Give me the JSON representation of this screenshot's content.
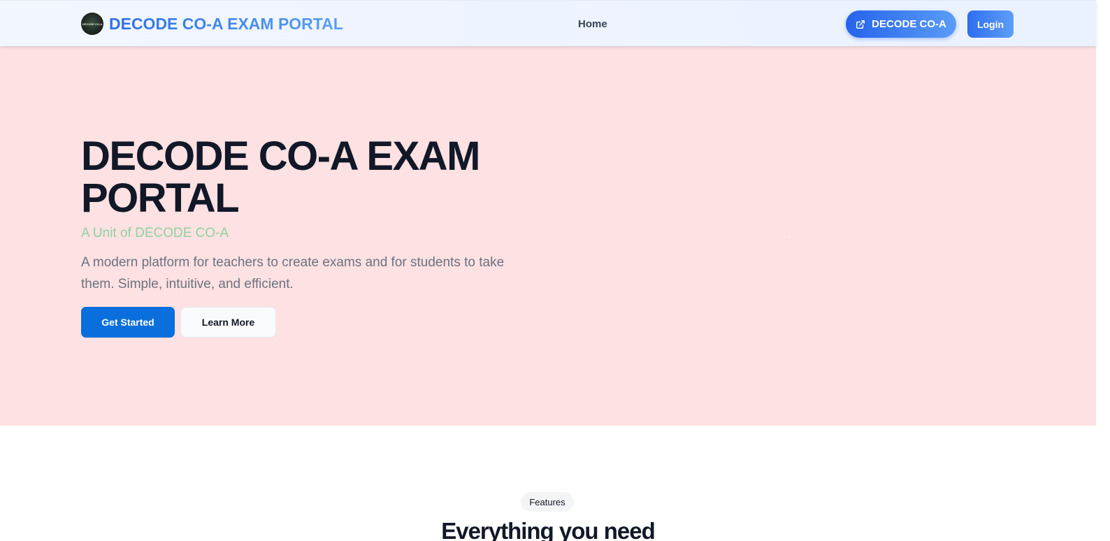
{
  "navbar": {
    "logo_text": "DECODE CO-A",
    "brand_title": "DECODE CO-A EXAM PORTAL",
    "links": [
      {
        "label": "Home"
      }
    ],
    "decode_button_label": "DECODE CO-A",
    "login_label": "Login"
  },
  "hero": {
    "title": "DECODE CO-A EXAM PORTAL",
    "subtitle": "A Unit of DECODE CO-A",
    "description": "A modern platform for teachers to create exams and for students to take them. Simple, intuitive, and efficient.",
    "primary_button": "Get Started",
    "secondary_button": "Learn More",
    "background_color": "#fee1e2"
  },
  "features": {
    "badge": "Features",
    "heading": "Everything you need"
  },
  "colors": {
    "accent": "#2563eb",
    "primary_button": "#0a6fdc",
    "subtitle": "#8fd19e"
  }
}
